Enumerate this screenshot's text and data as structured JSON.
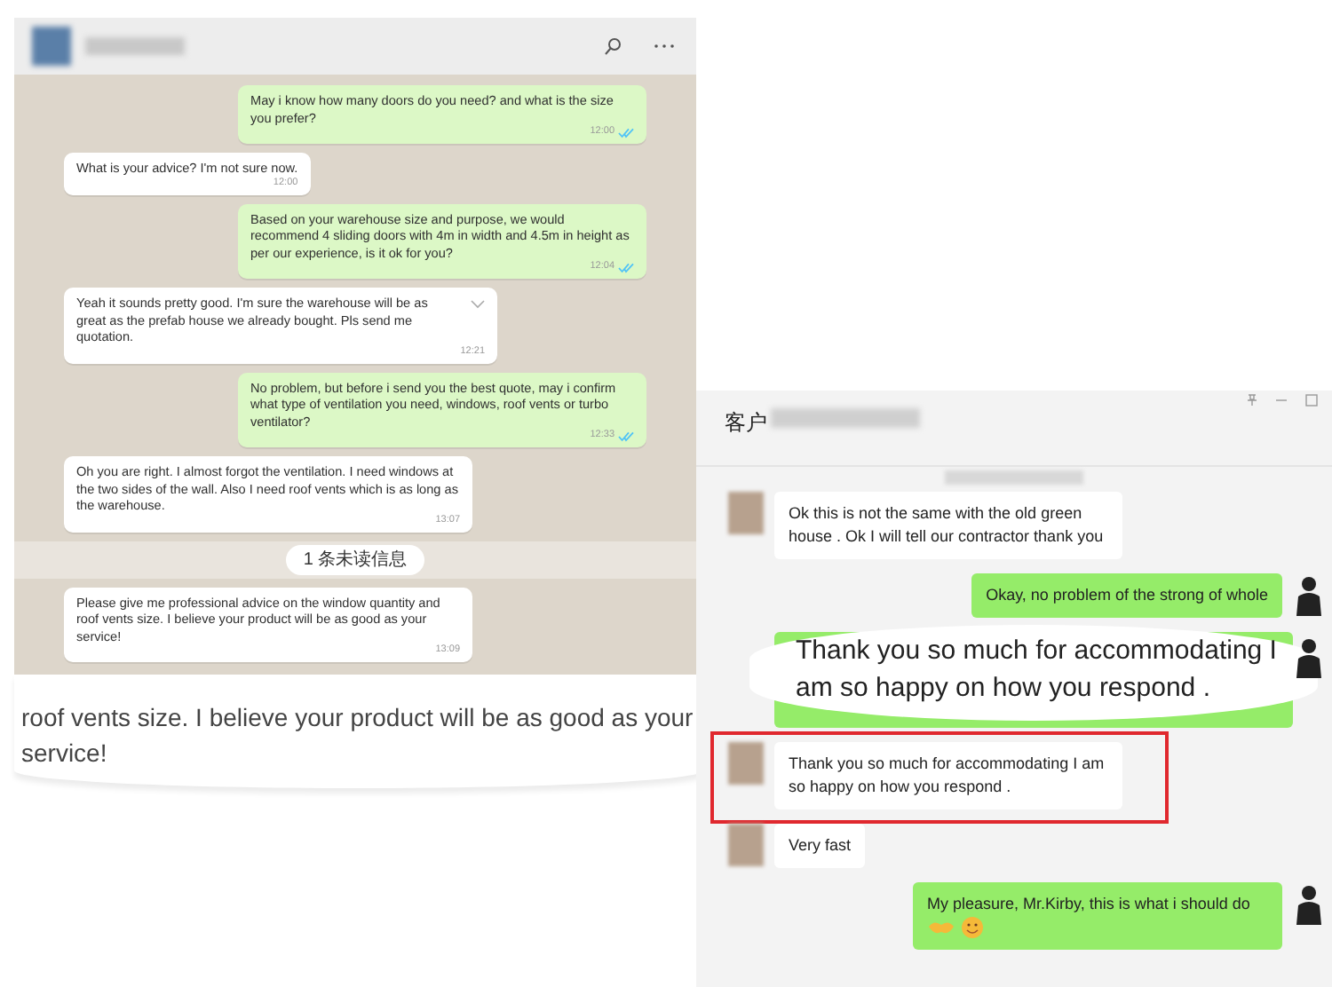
{
  "left_chat": {
    "messages": [
      {
        "kind": "outgoing",
        "text": "May i know how many doors do you need? and what is the size you prefer?",
        "time": "12:00",
        "read": true
      },
      {
        "kind": "incoming",
        "text": "What is your advice? I'm not sure now.",
        "time": "12:00"
      },
      {
        "kind": "outgoing",
        "text": "Based on your warehouse size and purpose, we would recommend 4 sliding doors with 4m in width and 4.5m in height as per our experience, is it ok for you?",
        "time": "12:04",
        "read": true
      },
      {
        "kind": "incoming",
        "text": "Yeah it sounds pretty good. I'm sure the warehouse will be as great as the prefab house we already bought. Pls send me quotation.",
        "time": "12:21",
        "menu": true
      },
      {
        "kind": "outgoing",
        "text": "No problem, but before i send you the best quote, may i confirm what type of ventilation you need, windows, roof vents or turbo ventilator?",
        "time": "12:33",
        "read": true
      },
      {
        "kind": "incoming",
        "text": "Oh you are right. I almost forgot the ventilation. I need windows at the two sides of the wall. Also I need roof vents which is as long as the warehouse.",
        "time": "13:07"
      },
      {
        "kind": "divider",
        "text": "1 条未读信息"
      },
      {
        "kind": "incoming",
        "text": "Please give me professional advice on the window quantity and roof vents size. I believe your product will be as good as your service!",
        "time": "13:09"
      }
    ]
  },
  "left_callout": {
    "lines": [
      "roof vents size. I believe your product will be as good as your",
      "service!"
    ]
  },
  "right_chat": {
    "title": "客户",
    "messages": [
      {
        "kind": "incoming",
        "text": "Ok this is not the same with the old green house . Ok I will tell our contractor thank you",
        "highlighted": false
      },
      {
        "kind": "outgoing",
        "text": "Okay, no problem of the strong of whole",
        "emojis": false
      },
      {
        "kind": "callout",
        "text": "Thank you so much for accommodating I am so happy on how you respond ."
      },
      {
        "kind": "incoming",
        "text": "Thank you so much for accommodating I am so happy on how you respond .",
        "highlighted": true
      },
      {
        "kind": "incoming",
        "text": "Very fast",
        "highlighted": false
      },
      {
        "kind": "outgoing",
        "text": "My pleasure, Mr.Kirby, this is what i should do",
        "emojis": true
      }
    ]
  }
}
